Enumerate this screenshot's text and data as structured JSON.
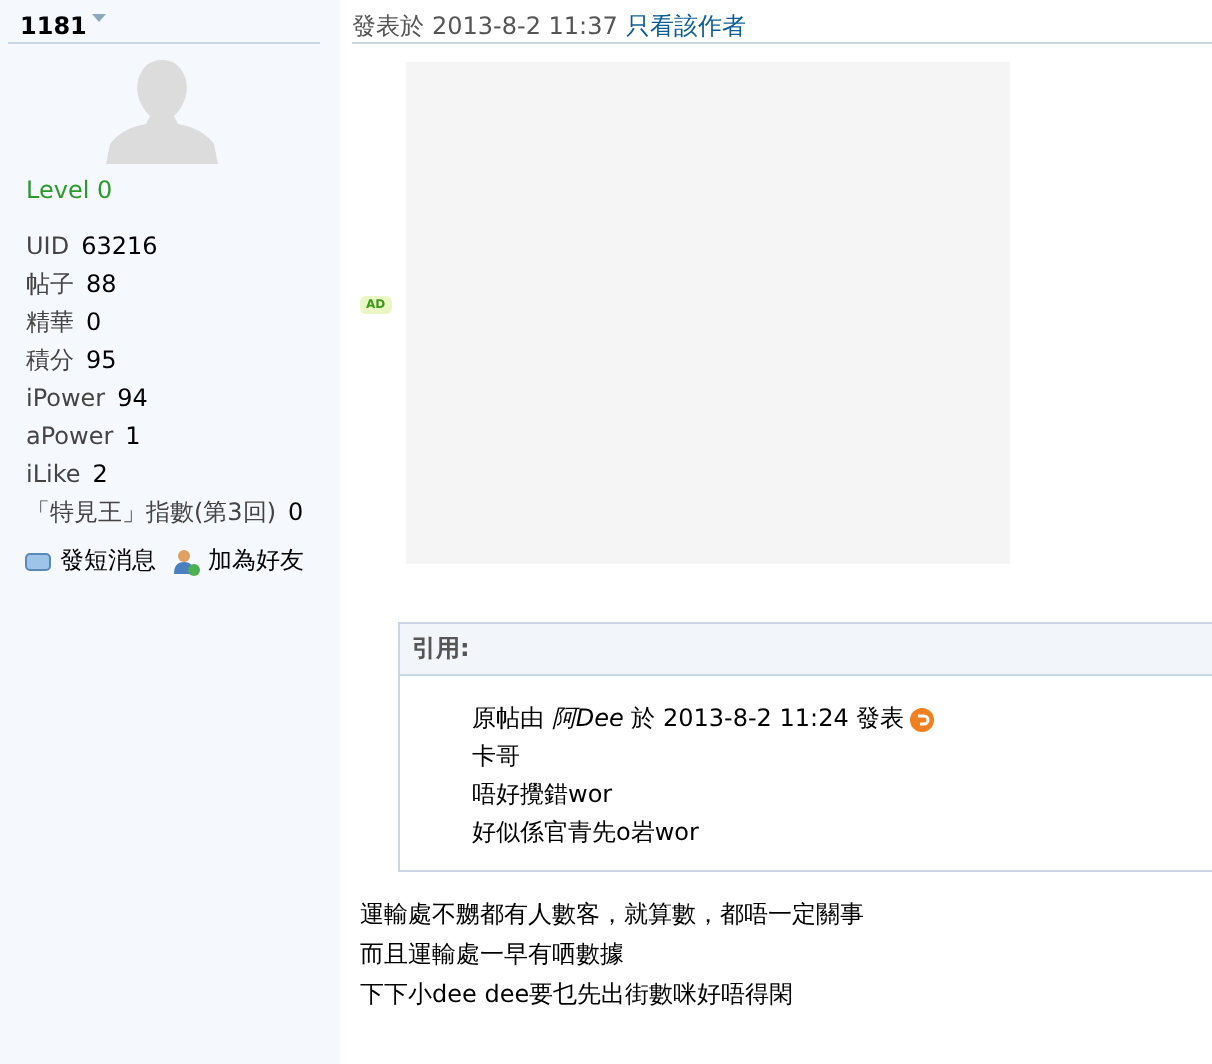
{
  "author": {
    "name": "1181",
    "level": "Level 0",
    "stats": [
      {
        "label": "UID",
        "value": "63216"
      },
      {
        "label": "帖子",
        "value": "88"
      },
      {
        "label": "精華",
        "value": "0"
      },
      {
        "label": "積分",
        "value": "95"
      },
      {
        "label": "iPower",
        "value": "94"
      },
      {
        "label": "aPower",
        "value": "1"
      },
      {
        "label": "iLike",
        "value": "2"
      },
      {
        "label": "「特見王」指數(第3回)",
        "value": "0"
      }
    ],
    "actions": [
      "發短消息",
      "加為好友"
    ]
  },
  "post": {
    "posted_label": "發表於",
    "posted_time": "2013-8-2 11:37",
    "author_only_link": "只看該作者",
    "ad_badge": "AD",
    "quote": {
      "title": "引用:",
      "source": "原帖由 *阿Dee* 於 2013-8-2 11:24 發表",
      "lines": [
        "卡哥",
        "唔好攪錯wor",
        "好似係官青先o岩wor"
      ]
    },
    "body": [
      "運輸處不嬲都有人數客，就算數，都唔一定關事",
      "而且運輸處一早有哂數據",
      "下下小dee dee要乜先出街數咪好唔得閑"
    ]
  }
}
